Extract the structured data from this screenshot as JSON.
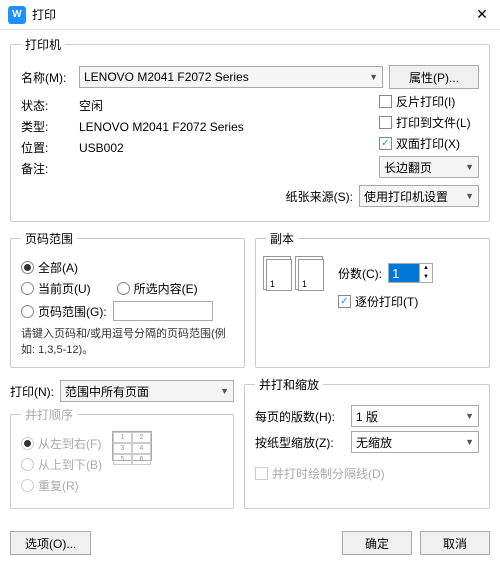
{
  "title": "打印",
  "printer": {
    "legend": "打印机",
    "name_label": "名称(M):",
    "name_value": "LENOVO M2041 F2072 Series",
    "properties_btn": "属性(P)...",
    "status_label": "状态:",
    "status_value": "空闲",
    "type_label": "类型:",
    "type_value": "LENOVO M2041 F2072 Series",
    "where_label": "位置:",
    "where_value": "USB002",
    "comment_label": "备注:",
    "reverse": "反片打印(I)",
    "to_file": "打印到文件(L)",
    "duplex": "双面打印(X)",
    "duplex_mode": "长边翻页",
    "source_label": "纸张来源(S):",
    "source_value": "使用打印机设置"
  },
  "range": {
    "legend": "页码范围",
    "all": "全部(A)",
    "current": "当前页(U)",
    "selection": "所选内容(E)",
    "pages": "页码范围(G):",
    "hint": "请键入页码和/或用逗号分隔的页码范围(例如: 1,3,5-12)。"
  },
  "copies": {
    "legend": "副本",
    "count_label": "份数(C):",
    "count_value": "1",
    "collate": "逐份打印(T)"
  },
  "print_what_label": "打印(N):",
  "print_what_value": "范围中所有页面",
  "zoom": {
    "legend": "并打和缩放",
    "pages_per_label": "每页的版数(H):",
    "pages_per_value": "1 版",
    "scale_label": "按纸型缩放(Z):",
    "scale_value": "无缩放",
    "draw_lines": "并打时绘制分隔线(D)"
  },
  "order": {
    "legend": "并打顺序",
    "lr": "从左到右(F)",
    "tb": "从上到下(B)",
    "repeat": "重复(R)"
  },
  "footer": {
    "options": "选项(O)...",
    "ok": "确定",
    "cancel": "取消"
  }
}
